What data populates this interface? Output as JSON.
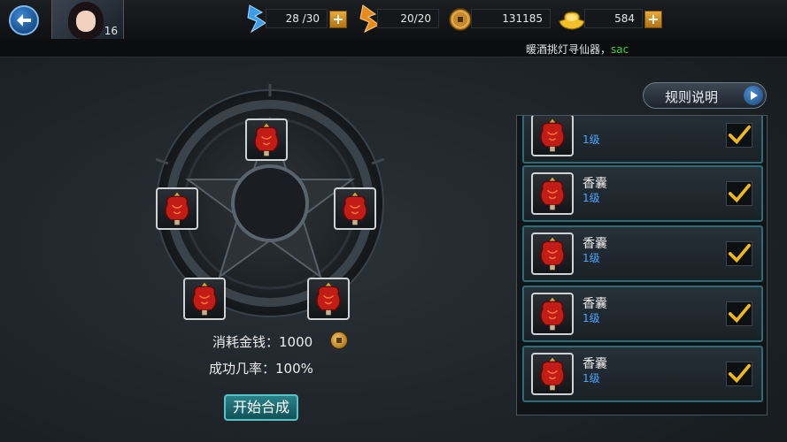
{
  "header": {
    "avatar_level": "16",
    "stamina": {
      "value": "28 /30",
      "icon": "stamina-icon"
    },
    "spirit": {
      "value": "20/20",
      "icon": "spirit-icon"
    },
    "coins": {
      "value": "131185",
      "icon": "coin-icon"
    },
    "gold": {
      "value": "584",
      "icon": "gold-ingot-icon"
    },
    "plus_label": "+"
  },
  "ticker": {
    "message": "暖酒挑灯寻仙器，",
    "name": "sac"
  },
  "synthesis": {
    "cost_label": "消耗金钱：1000",
    "rate_label": "成功几率：100%",
    "start_button": "开始合成"
  },
  "rules_button": "规则说明",
  "items": [
    {
      "name": "",
      "level": "1级",
      "checked": true
    },
    {
      "name": "香囊",
      "level": "1级",
      "checked": true
    },
    {
      "name": "香囊",
      "level": "1级",
      "checked": true
    },
    {
      "name": "香囊",
      "level": "1级",
      "checked": true
    },
    {
      "name": "香囊",
      "level": "1级",
      "checked": true
    }
  ],
  "colors": {
    "accent_teal": "#2a6d78",
    "level_blue": "#4aa6ff",
    "check_gold": "#f0b818",
    "ticker_name": "#3fcf3f"
  }
}
